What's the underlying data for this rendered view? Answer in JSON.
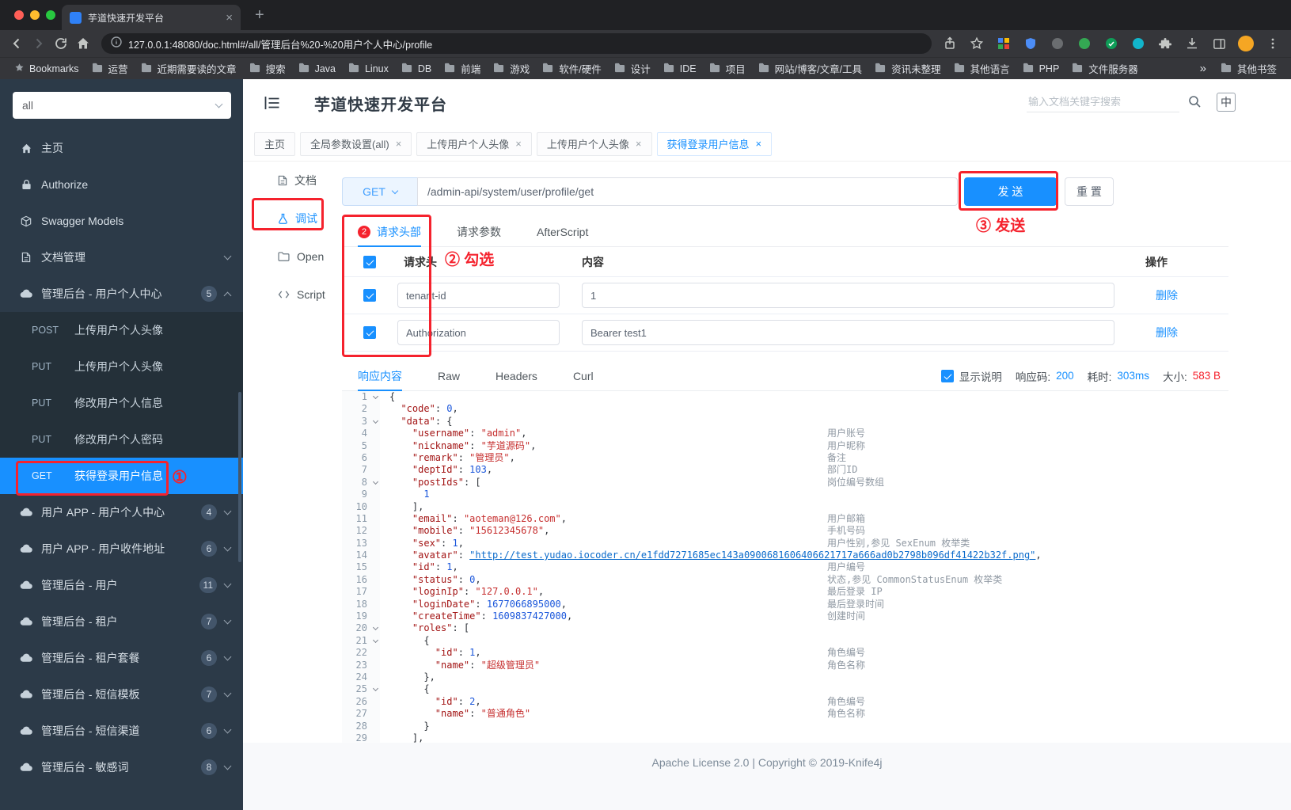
{
  "colors": {
    "accent": "#1890ff",
    "annotation": "#f5222d",
    "active_item_bg": "#1890ff",
    "traffic_lights": [
      "#ff5f57",
      "#febc2e",
      "#28c840"
    ]
  },
  "icons": {
    "close": "×",
    "new_tab": "+",
    "overflow": "»"
  },
  "browser": {
    "tab_title": "芋道快速开发平台",
    "url": "127.0.0.1:48080/doc.html#/all/管理后台%20-%20用户个人中心/profile",
    "bookmarks_label": "Bookmarks",
    "bookmarks": [
      "运营",
      "近期需要读的文章",
      "搜索",
      "Java",
      "Linux",
      "DB",
      "前端",
      "游戏",
      "软件/硬件",
      "设计",
      "IDE",
      "项目",
      "网站/博客/文章/工具",
      "资讯未整理",
      "其他语言",
      "PHP",
      "文件服务器"
    ],
    "other_bookmarks": "其他书签"
  },
  "sidebar": {
    "group_selected": "all",
    "menu": [
      {
        "label": "主页",
        "icon": "home-icon"
      },
      {
        "label": "Authorize",
        "icon": "lock-icon"
      },
      {
        "label": "Swagger Models",
        "icon": "models-icon"
      },
      {
        "label": "文档管理",
        "icon": "docs-icon",
        "chevron": "down"
      },
      {
        "label": "管理后台 - 用户个人中心",
        "icon": "cloud-icon",
        "badge": "5",
        "chevron": "up",
        "children": [
          {
            "method": "POST",
            "label": "上传用户个人头像"
          },
          {
            "method": "PUT",
            "label": "上传用户个人头像"
          },
          {
            "method": "PUT",
            "label": "修改用户个人信息"
          },
          {
            "method": "PUT",
            "label": "修改用户个人密码"
          },
          {
            "method": "GET",
            "label": "获得登录用户信息",
            "active": true
          }
        ]
      },
      {
        "label": "用户 APP - 用户个人中心",
        "icon": "cloud-icon",
        "badge": "4",
        "chevron": "down"
      },
      {
        "label": "用户 APP - 用户收件地址",
        "icon": "cloud-icon",
        "badge": "6",
        "chevron": "down"
      },
      {
        "label": "管理后台 - 用户",
        "icon": "cloud-icon",
        "badge": "11",
        "chevron": "down"
      },
      {
        "label": "管理后台 - 租户",
        "icon": "cloud-icon",
        "badge": "7",
        "chevron": "down"
      },
      {
        "label": "管理后台 - 租户套餐",
        "icon": "cloud-icon",
        "badge": "6",
        "chevron": "down"
      },
      {
        "label": "管理后台 - 短信模板",
        "icon": "cloud-icon",
        "badge": "7",
        "chevron": "down"
      },
      {
        "label": "管理后台 - 短信渠道",
        "icon": "cloud-icon",
        "badge": "6",
        "chevron": "down"
      },
      {
        "label": "管理后台 - 敏感词",
        "icon": "cloud-icon",
        "badge": "8",
        "chevron": "down"
      }
    ]
  },
  "header": {
    "title": "芋道快速开发平台",
    "search_placeholder": "输入文档关键字搜索",
    "lang_icon": "中"
  },
  "doc_tabs": [
    {
      "label": "主页",
      "closable": false
    },
    {
      "label": "全局参数设置(all)",
      "closable": true
    },
    {
      "label": "上传用户个人头像",
      "closable": true
    },
    {
      "label": "上传用户个人头像",
      "closable": true
    },
    {
      "label": "获得登录用户信息",
      "closable": true,
      "active": true
    }
  ],
  "inner_tabs": [
    {
      "label": "文档",
      "icon": "doc-icon"
    },
    {
      "label": "调试",
      "icon": "debug-icon",
      "active": true
    },
    {
      "label": "Open",
      "icon": "open-icon"
    },
    {
      "label": "Script",
      "icon": "script-icon"
    }
  ],
  "debug": {
    "method": "GET",
    "url": "/admin-api/system/user/profile/get",
    "send_label": "发 送",
    "reset_label": "重 置",
    "tabs": [
      {
        "label": "请求头部",
        "badge": "2",
        "active": true
      },
      {
        "label": "请求参数"
      },
      {
        "label": "AfterScript"
      }
    ],
    "table": {
      "check_all": true,
      "columns": {
        "name": "请求头",
        "value": "内容",
        "action": "操作"
      },
      "rows": [
        {
          "checked": true,
          "name": "tenant-id",
          "value": "1",
          "action": "删除"
        },
        {
          "checked": true,
          "name": "Authorization",
          "value": "Bearer test1",
          "action": "删除"
        }
      ]
    }
  },
  "response": {
    "tabs": [
      {
        "label": "响应内容",
        "active": true
      },
      {
        "label": "Raw"
      },
      {
        "label": "Headers"
      },
      {
        "label": "Curl"
      }
    ],
    "show_desc_checked": true,
    "show_desc": "显示说明",
    "status_label": "响应码:",
    "status_value": "200",
    "time_label": "耗时:",
    "time_value": "303ms",
    "size_label": "大小:",
    "size_value": "583 B",
    "code_lines": [
      {
        "n": 1,
        "fold": true,
        "seg": [
          [
            "p",
            "{"
          ]
        ]
      },
      {
        "n": 2,
        "seg": [
          [
            "p",
            "  "
          ],
          [
            "k",
            "\"code\""
          ],
          [
            "p",
            ": "
          ],
          [
            "d",
            "0"
          ],
          [
            "p",
            ","
          ]
        ]
      },
      {
        "n": 3,
        "fold": true,
        "seg": [
          [
            "p",
            "  "
          ],
          [
            "k",
            "\"data\""
          ],
          [
            "p",
            ": {"
          ]
        ]
      },
      {
        "n": 4,
        "seg": [
          [
            "p",
            "    "
          ],
          [
            "k",
            "\"username\""
          ],
          [
            "p",
            ": "
          ],
          [
            "s",
            "\"admin\""
          ],
          [
            "p",
            ","
          ]
        ],
        "cmt": "用户账号"
      },
      {
        "n": 5,
        "seg": [
          [
            "p",
            "    "
          ],
          [
            "k",
            "\"nickname\""
          ],
          [
            "p",
            ": "
          ],
          [
            "s",
            "\"芋道源码\""
          ],
          [
            "p",
            ","
          ]
        ],
        "cmt": "用户昵称"
      },
      {
        "n": 6,
        "seg": [
          [
            "p",
            "    "
          ],
          [
            "k",
            "\"remark\""
          ],
          [
            "p",
            ": "
          ],
          [
            "s",
            "\"管理员\""
          ],
          [
            "p",
            ","
          ]
        ],
        "cmt": "备注"
      },
      {
        "n": 7,
        "seg": [
          [
            "p",
            "    "
          ],
          [
            "k",
            "\"deptId\""
          ],
          [
            "p",
            ": "
          ],
          [
            "d",
            "103"
          ],
          [
            "p",
            ","
          ]
        ],
        "cmt": "部门ID"
      },
      {
        "n": 8,
        "fold": true,
        "seg": [
          [
            "p",
            "    "
          ],
          [
            "k",
            "\"postIds\""
          ],
          [
            "p",
            ": ["
          ]
        ],
        "cmt": "岗位编号数组"
      },
      {
        "n": 9,
        "seg": [
          [
            "p",
            "      "
          ],
          [
            "d",
            "1"
          ]
        ]
      },
      {
        "n": 10,
        "seg": [
          [
            "p",
            "    ],"
          ]
        ]
      },
      {
        "n": 11,
        "seg": [
          [
            "p",
            "    "
          ],
          [
            "k",
            "\"email\""
          ],
          [
            "p",
            ": "
          ],
          [
            "s",
            "\"aoteman@126.com\""
          ],
          [
            "p",
            ","
          ]
        ],
        "cmt": "用户邮箱"
      },
      {
        "n": 12,
        "seg": [
          [
            "p",
            "    "
          ],
          [
            "k",
            "\"mobile\""
          ],
          [
            "p",
            ": "
          ],
          [
            "s",
            "\"15612345678\""
          ],
          [
            "p",
            ","
          ]
        ],
        "cmt": "手机号码"
      },
      {
        "n": 13,
        "seg": [
          [
            "p",
            "    "
          ],
          [
            "k",
            "\"sex\""
          ],
          [
            "p",
            ": "
          ],
          [
            "d",
            "1"
          ],
          [
            "p",
            ","
          ]
        ],
        "cmt": "用户性别,参见 SexEnum 枚举类"
      },
      {
        "n": 14,
        "seg": [
          [
            "p",
            "    "
          ],
          [
            "k",
            "\"avatar\""
          ],
          [
            "p",
            ": "
          ],
          [
            "u",
            "\"http://test.yudao.iocoder.cn/e1fdd7271685ec143a0900681606406621717a666ad0b2798b096df41422b32f.png\""
          ],
          [
            "p",
            ","
          ]
        ]
      },
      {
        "n": 15,
        "seg": [
          [
            "p",
            "    "
          ],
          [
            "k",
            "\"id\""
          ],
          [
            "p",
            ": "
          ],
          [
            "d",
            "1"
          ],
          [
            "p",
            ","
          ]
        ],
        "cmt": "用户编号"
      },
      {
        "n": 16,
        "seg": [
          [
            "p",
            "    "
          ],
          [
            "k",
            "\"status\""
          ],
          [
            "p",
            ": "
          ],
          [
            "d",
            "0"
          ],
          [
            "p",
            ","
          ]
        ],
        "cmt": "状态,参见 CommonStatusEnum 枚举类"
      },
      {
        "n": 17,
        "seg": [
          [
            "p",
            "    "
          ],
          [
            "k",
            "\"loginIp\""
          ],
          [
            "p",
            ": "
          ],
          [
            "s",
            "\"127.0.0.1\""
          ],
          [
            "p",
            ","
          ]
        ],
        "cmt": "最后登录 IP"
      },
      {
        "n": 18,
        "seg": [
          [
            "p",
            "    "
          ],
          [
            "k",
            "\"loginDate\""
          ],
          [
            "p",
            ": "
          ],
          [
            "d",
            "1677066895000"
          ],
          [
            "p",
            ","
          ]
        ],
        "cmt": "最后登录时间"
      },
      {
        "n": 19,
        "seg": [
          [
            "p",
            "    "
          ],
          [
            "k",
            "\"createTime\""
          ],
          [
            "p",
            ": "
          ],
          [
            "d",
            "1609837427000"
          ],
          [
            "p",
            ","
          ]
        ],
        "cmt": "创建时间"
      },
      {
        "n": 20,
        "fold": true,
        "seg": [
          [
            "p",
            "    "
          ],
          [
            "k",
            "\"roles\""
          ],
          [
            "p",
            ": ["
          ]
        ]
      },
      {
        "n": 21,
        "fold": true,
        "seg": [
          [
            "p",
            "      {"
          ]
        ]
      },
      {
        "n": 22,
        "seg": [
          [
            "p",
            "        "
          ],
          [
            "k",
            "\"id\""
          ],
          [
            "p",
            ": "
          ],
          [
            "d",
            "1"
          ],
          [
            "p",
            ","
          ]
        ],
        "cmt": "角色编号"
      },
      {
        "n": 23,
        "seg": [
          [
            "p",
            "        "
          ],
          [
            "k",
            "\"name\""
          ],
          [
            "p",
            ": "
          ],
          [
            "s",
            "\"超级管理员\""
          ]
        ],
        "cmt": "角色名称"
      },
      {
        "n": 24,
        "seg": [
          [
            "p",
            "      },"
          ]
        ]
      },
      {
        "n": 25,
        "fold": true,
        "seg": [
          [
            "p",
            "      {"
          ]
        ]
      },
      {
        "n": 26,
        "seg": [
          [
            "p",
            "        "
          ],
          [
            "k",
            "\"id\""
          ],
          [
            "p",
            ": "
          ],
          [
            "d",
            "2"
          ],
          [
            "p",
            ","
          ]
        ],
        "cmt": "角色编号"
      },
      {
        "n": 27,
        "seg": [
          [
            "p",
            "        "
          ],
          [
            "k",
            "\"name\""
          ],
          [
            "p",
            ": "
          ],
          [
            "s",
            "\"普通角色\""
          ]
        ],
        "cmt": "角色名称"
      },
      {
        "n": 28,
        "seg": [
          [
            "p",
            "      }"
          ]
        ]
      },
      {
        "n": 29,
        "seg": [
          [
            "p",
            "    ],"
          ]
        ]
      }
    ]
  },
  "footer": {
    "text": "Apache License 2.0 | Copyright © 2019-Knife4j"
  },
  "annotations": {
    "step1": "①",
    "step2": "② 勾选",
    "step3": "③ 发送"
  }
}
